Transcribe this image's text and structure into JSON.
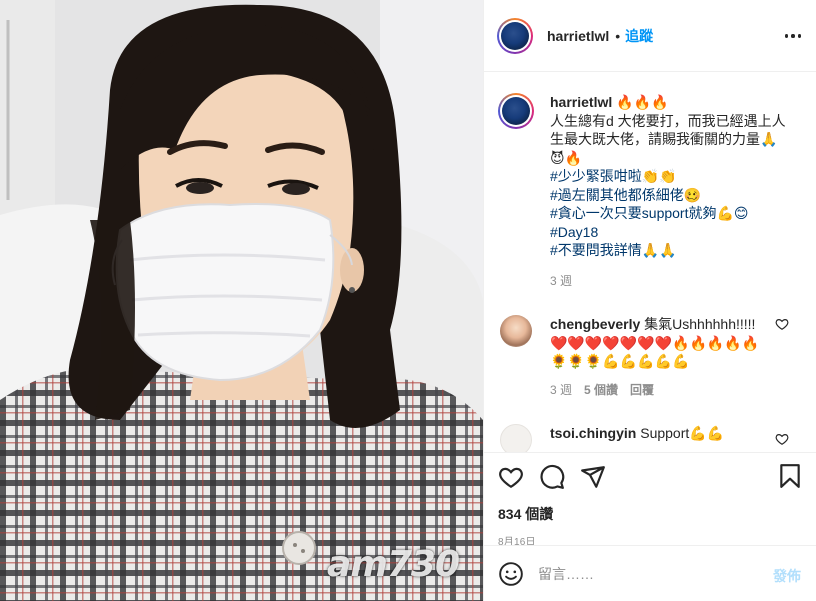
{
  "post": {
    "username": "harrietlwl",
    "follow_label": "追蹤",
    "separator": "•"
  },
  "caption": {
    "username": "harrietlwl",
    "username_emoji": "🔥🔥🔥",
    "text": "人生總有d 大佬要打，而我已經遇上人生最大既大佬，請賜我衝關的力量🙏",
    "emoji_line": "😈🔥",
    "hashtags": [
      "#少少緊張咁啦👏👏",
      "#過左關其他都係細佬🥴",
      "#貪心一次只要support就夠💪😊",
      "#Day18",
      "#不要問我詳情🙏🙏"
    ],
    "time": "3 週"
  },
  "comments": [
    {
      "username": "chengbeverly",
      "text": "集氣Ushhhhhh!!!!!",
      "emoji": "❤️❤️❤️❤️❤️❤️❤️🔥🔥🔥🔥🔥🌻🌻🌻💪💪💪💪💪",
      "time": "3 週",
      "likes": "5 個讚",
      "reply": "回覆"
    },
    {
      "username": "tsoi.chingyin",
      "text": "Support💪💪"
    }
  ],
  "actions": {
    "likes": "834 個讚",
    "date": "8月16日"
  },
  "add_comment": {
    "placeholder": "留言……",
    "post_label": "發佈"
  },
  "watermark": "am730",
  "icons": [
    "more-icon",
    "heart-icon",
    "comment-icon",
    "share-icon",
    "bookmark-icon",
    "emoji-icon"
  ]
}
